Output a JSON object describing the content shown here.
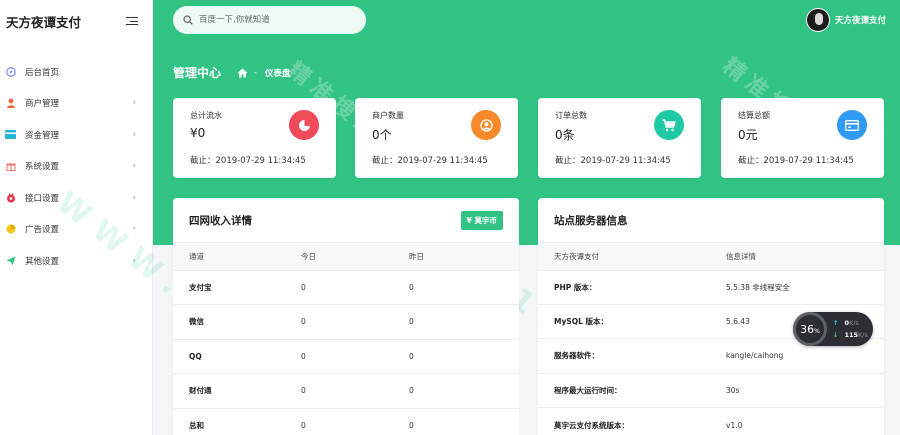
{
  "sidebar": {
    "brand": "天方夜谭支付",
    "items": [
      {
        "label": "后台首页",
        "icon": "compass-icon",
        "color": "#6b7cff",
        "has_arrow": false
      },
      {
        "label": "商户管理",
        "icon": "user-icon",
        "color": "#f0643c",
        "has_arrow": true
      },
      {
        "label": "资金管理",
        "icon": "card-icon",
        "color": "#1fb8d6",
        "has_arrow": true
      },
      {
        "label": "系统设置",
        "icon": "gift-icon",
        "color": "#f07070",
        "has_arrow": true
      },
      {
        "label": "接口设置",
        "icon": "plug-icon",
        "color": "#e8334a",
        "has_arrow": true
      },
      {
        "label": "广告设置",
        "icon": "pie-icon",
        "color": "#f5c518",
        "has_arrow": true
      },
      {
        "label": "其他设置",
        "icon": "send-icon",
        "color": "#31c383",
        "has_arrow": true
      }
    ]
  },
  "header": {
    "search_placeholder": "百度一下,你就知道",
    "user_name": "天方夜谭支付",
    "page_title": "管理中心",
    "breadcrumb_sep": "-",
    "breadcrumb": "仪表盘",
    "accent": "#31c383"
  },
  "watermark": {
    "text_cn": "精准搜素",
    "text_url": "WWW.11PX.CN"
  },
  "stats": [
    {
      "title": "总计流水",
      "value": "¥0",
      "time": "截止：2019-07-29 11:34:45",
      "icon": "pie-chart-icon",
      "color": "#f04a5a"
    },
    {
      "title": "商户数量",
      "value": "0个",
      "time": "截止：2019-07-29 11:34:45",
      "icon": "user-circle-icon",
      "color": "#f98a2c"
    },
    {
      "title": "订单总数",
      "value": "0条",
      "time": "截止：2019-07-29 11:34:45",
      "icon": "cart-icon",
      "color": "#20c9a6"
    },
    {
      "title": "结算总额",
      "value": "0元",
      "time": "截止：2019-07-29 11:34:45",
      "icon": "card-icon",
      "color": "#2f9bf4"
    }
  ],
  "income": {
    "title": "四网收入详情",
    "button": "¥ 莫宇币",
    "columns": [
      "通道",
      "今日",
      "昨日"
    ],
    "rows": [
      [
        "支付宝",
        "0",
        "0"
      ],
      [
        "微信",
        "0",
        "0"
      ],
      [
        "QQ",
        "0",
        "0"
      ],
      [
        "财付通",
        "0",
        "0"
      ],
      [
        "总和",
        "0",
        "0"
      ]
    ]
  },
  "server": {
    "title": "站点服务器信息",
    "columns": [
      "天方夜谭支付",
      "信息详情"
    ],
    "rows": [
      [
        "PHP 版本：",
        "5.5.38 非线程安全"
      ],
      [
        "MySQL 版本：",
        "5.6.43"
      ],
      [
        "服务器软件：",
        "kangle/caihong"
      ],
      [
        "程序最大运行时间：",
        "30s"
      ],
      [
        "莫宇云支付系统版本：",
        "v1.0"
      ]
    ]
  },
  "speed": {
    "percent": "36",
    "percent_unit": "%",
    "up": "0",
    "down": "115",
    "unit": "K/s"
  }
}
